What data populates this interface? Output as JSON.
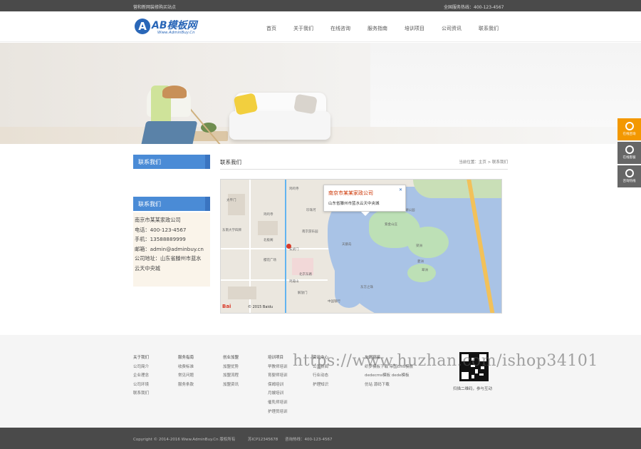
{
  "topbar": {
    "left": "营和新网装修购买站点",
    "right": "全国服务热线：400-123-4567"
  },
  "logo": {
    "letter": "A",
    "name": "AB模板网",
    "url": "Www.AdminBuy.Cn"
  },
  "nav": [
    "首页",
    "关于我们",
    "在线咨询",
    "服务指南",
    "培训项目",
    "公司资讯",
    "联系我们"
  ],
  "sidebar": {
    "title1": "联系我们",
    "title2": "联系我们",
    "contact": [
      "南京市某某家政公司",
      "电话：400-123-4567",
      "手机：13588889999",
      "邮箱：admin@adminbuy.cn",
      "公司地址：山东省滕州市蓝水",
      "云天中央城"
    ]
  },
  "content": {
    "title": "联系我们",
    "breadcrumb": "当前位置：主页 > 联系我们"
  },
  "map": {
    "popup_title": "南京市某某家政公司",
    "popup_address": "山东省滕州市蓝水云天中央城",
    "close": "✕",
    "copyright": "© 2015 Baidu",
    "logo": "Bai",
    "labels": [
      "鸡鸣寺",
      "太平门",
      "东南大学四牌",
      "鸡鸣寺",
      "北极阁",
      "珍珠河",
      "玄武门",
      "北京东路",
      "中国银行",
      "樱花广场",
      "玄武湖公园",
      "紫金山庄",
      "天鹅岛",
      "梁洲",
      "东方之珠",
      "翠洲",
      "菱洲",
      "解放门",
      "南京游乐园",
      "鸡笼山"
    ]
  },
  "footer": {
    "cols": [
      {
        "head": "关于我们",
        "items": [
          "公司简介",
          "企业理念",
          "公司环境",
          "联系我们"
        ]
      },
      {
        "head": "服务指南",
        "items": [
          "收费标准",
          "常见问题",
          "服务条款"
        ]
      },
      {
        "head": "创业加盟",
        "items": [
          "加盟优势",
          "加盟流程",
          "加盟资讯"
        ]
      },
      {
        "head": "培训项目",
        "items": [
          "早教师培训",
          "育婴师培训",
          "保姆培训",
          "月嫂培训",
          "催乳师培训",
          "护理员培训"
        ]
      },
      {
        "head": "资讯中心",
        "items": [
          "公司新闻",
          "行业动态",
          "护理知识"
        ]
      },
      {
        "head": "友情链接",
        "items": [
          "织梦模板下载",
          "帝国cms模板",
          "dedecms模板",
          "dede模板",
          "仿站",
          "源码下载"
        ]
      }
    ],
    "qr_text": "扫描二维码，参与互动",
    "watermark": "https://www.huzhan.com/ishop34101"
  },
  "bottombar": {
    "copyright": "Copyright © 2014-2016 Www.AdminBuy.Cn 版权所有",
    "icp": "苏ICP12345678",
    "hotline": "咨询热线：400-123-4567"
  },
  "float": [
    {
      "label": "在线咨询",
      "icon": "qq-icon",
      "color": "#f39800"
    },
    {
      "label": "在线客服",
      "icon": "service-icon",
      "color": "#666666"
    },
    {
      "label": "咨询热线",
      "icon": "phone-icon",
      "color": "#666666"
    }
  ]
}
